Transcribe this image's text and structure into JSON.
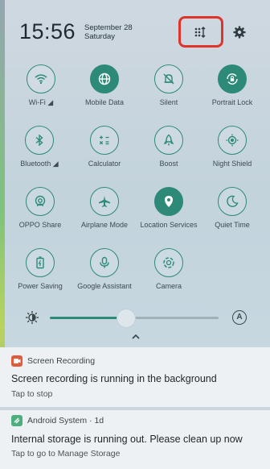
{
  "status": {
    "time": "15:56",
    "date_line1": "September 28",
    "date_line2": "Saturday"
  },
  "header": {
    "edit_icon": "tile-order-icon",
    "settings_icon": "gear-icon"
  },
  "tiles": [
    {
      "label": "Wi-Fi",
      "icon": "wifi-icon",
      "on": false,
      "has_arrow": true
    },
    {
      "label": "Mobile Data",
      "icon": "globe-icon",
      "on": true
    },
    {
      "label": "Silent",
      "icon": "silent-icon",
      "on": false
    },
    {
      "label": "Portrait Lock",
      "icon": "rotation-lock-icon",
      "on": true
    },
    {
      "label": "Bluetooth",
      "icon": "bluetooth-icon",
      "on": false,
      "has_arrow": true
    },
    {
      "label": "Calculator",
      "icon": "calculator-icon",
      "on": false
    },
    {
      "label": "Boost",
      "icon": "boost-icon",
      "on": false
    },
    {
      "label": "Night Shield",
      "icon": "night-shield-icon",
      "on": false
    },
    {
      "label": "OPPO Share",
      "icon": "share-icon",
      "on": false
    },
    {
      "label": "Airplane Mode",
      "icon": "airplane-icon",
      "on": false
    },
    {
      "label": "Location Services",
      "icon": "location-icon",
      "on": true
    },
    {
      "label": "Quiet Time",
      "icon": "moon-icon",
      "on": false
    },
    {
      "label": "Power Saving",
      "icon": "battery-icon",
      "on": false
    },
    {
      "label": "Google Assistant",
      "icon": "microphone-icon",
      "on": false
    },
    {
      "label": "Camera",
      "icon": "camera-icon",
      "on": false
    }
  ],
  "brightness": {
    "level": 0.45,
    "auto_label": "A"
  },
  "notifications": [
    {
      "app": "Screen Recording",
      "title": "Screen recording is running in the background",
      "subtitle": "Tap to stop",
      "icon_color": "#e05a3c"
    },
    {
      "app": "Android System · 1d",
      "title": "Internal storage is running out. Please clean up now",
      "subtitle": "Tap to go to Manage Storage",
      "icon_color": "#4caf7d"
    }
  ],
  "colors": {
    "accent": "#2e8a78",
    "highlight": "#e0342b"
  }
}
